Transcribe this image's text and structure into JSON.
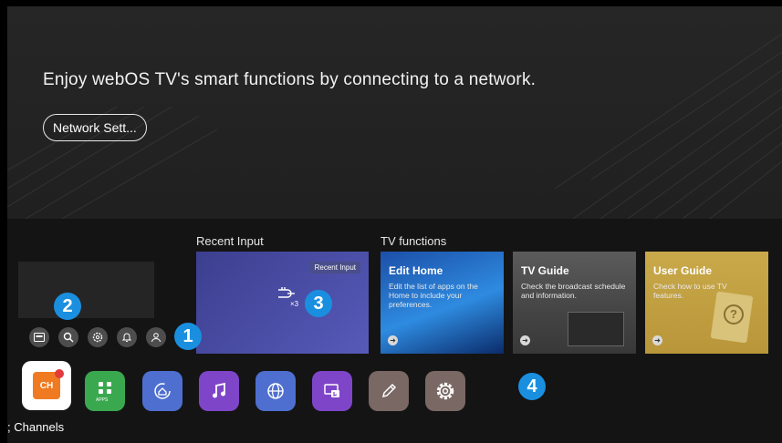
{
  "hero": {
    "message": "Enjoy webOS TV's smart functions by connecting to a network.",
    "network_button": "Network Sett..."
  },
  "recent_input": {
    "section_title": "Recent Input",
    "card_label": "Recent Input",
    "count": "×3"
  },
  "tv_functions": {
    "section_title": "TV functions",
    "cards": [
      {
        "title": "Edit Home",
        "desc": "Edit the list of apps on the Home to include your preferences."
      },
      {
        "title": "TV Guide",
        "desc": "Check the broadcast schedule and information."
      },
      {
        "title": "User Guide",
        "desc": "Check how to use TV features."
      }
    ]
  },
  "quick_icons": [
    "input-icon",
    "search-icon",
    "settings-icon",
    "notification-icon",
    "profile-icon"
  ],
  "badges": [
    "1",
    "2",
    "3",
    "4"
  ],
  "apps": {
    "live_label": "CH",
    "apps_label": "APPS",
    "focused_caption": "; Channels",
    "items": [
      "live-tv",
      "apps",
      "home-dashboard",
      "music",
      "web-browser",
      "media-player",
      "art-edit",
      "settings"
    ]
  },
  "colors": {
    "badge": "#1a8fe0",
    "apps_green": "#3aa84f",
    "music_purple": "#7f45c9",
    "browser_blue": "#4e6fcf",
    "edit_grey": "#7a6864"
  }
}
